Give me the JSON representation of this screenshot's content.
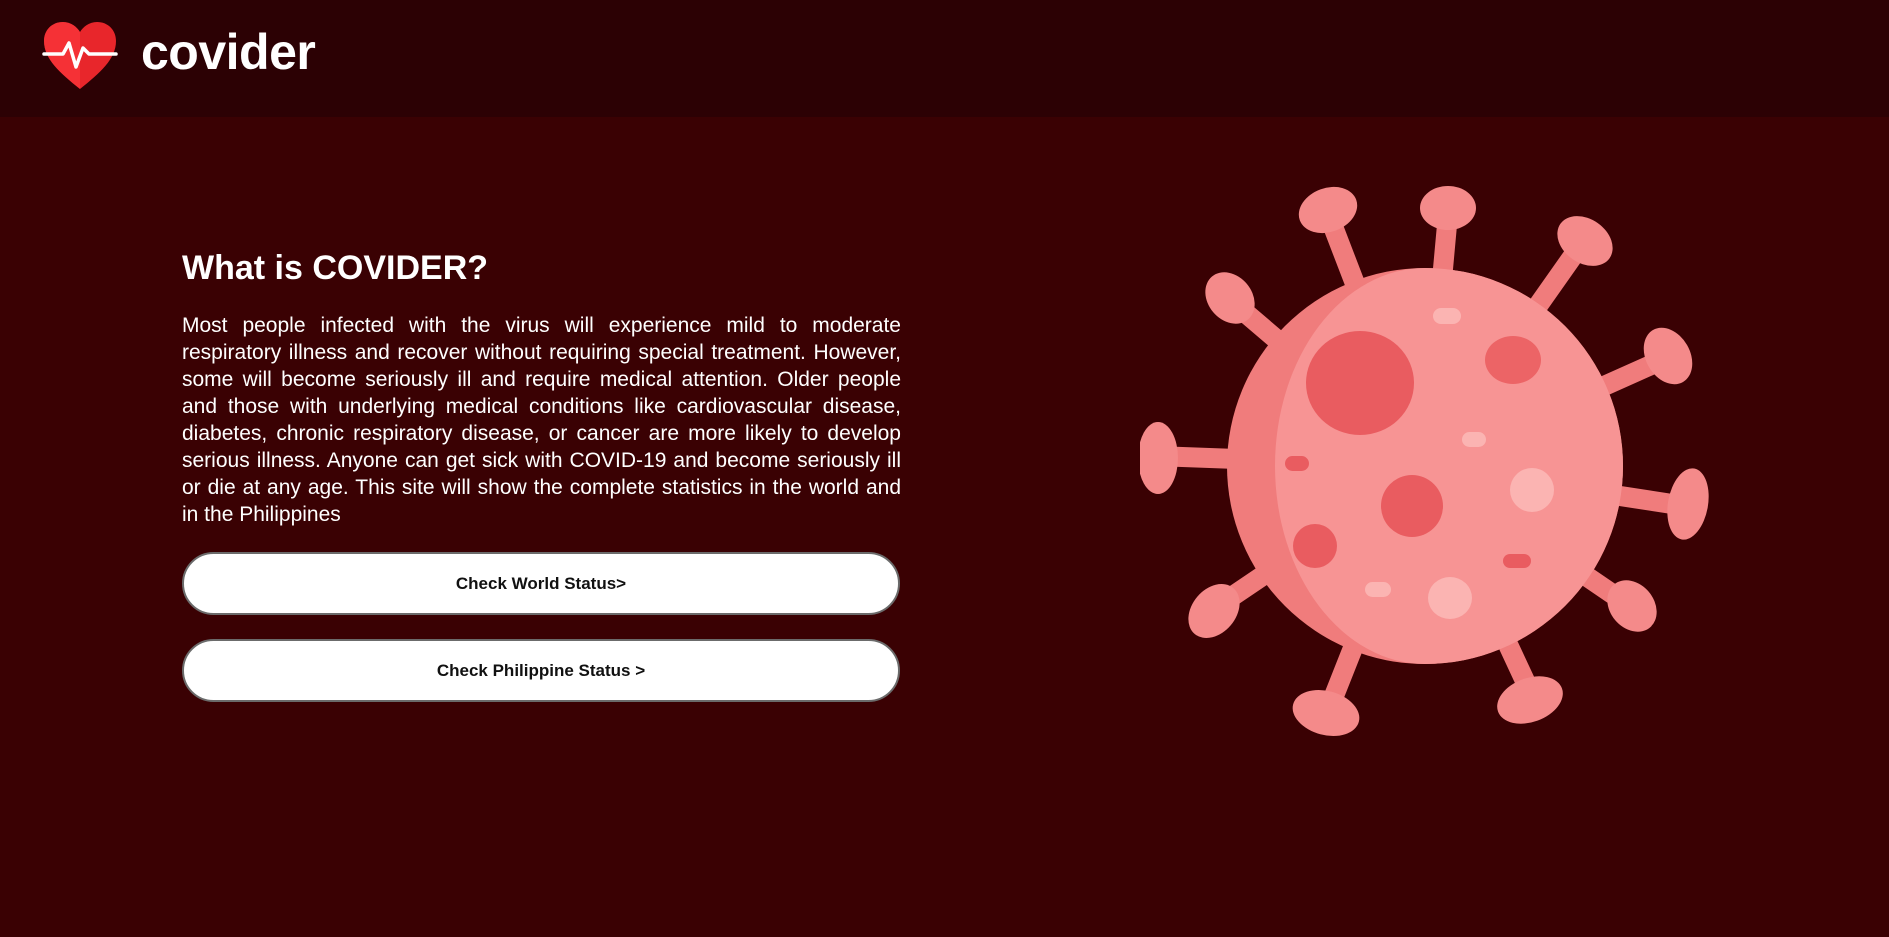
{
  "header": {
    "brand": "covider",
    "logo_icon": "heart-pulse-icon"
  },
  "main": {
    "heading": "What is COVIDER?",
    "description": "Most people infected with the virus will experience mild to moderate respiratory illness and recover without requiring special treatment. However, some will become seriously ill and require medical attention. Older people and those with underlying medical conditions like cardiovascular disease, diabetes, chronic respiratory disease, or cancer are more likely to develop serious illness. Anyone can get sick with COVID-19 and become seriously ill or die at any age. This site will show the complete statistics in the world and in the Philippines",
    "buttons": {
      "world": "Check World Status>",
      "philippines": "Check Philippine Status >"
    },
    "illustration_icon": "virus-icon"
  },
  "colors": {
    "page_background": "#3a0103",
    "header_background": "#2c0104",
    "heart": "#e8262b",
    "virus": "#f48a8a"
  }
}
